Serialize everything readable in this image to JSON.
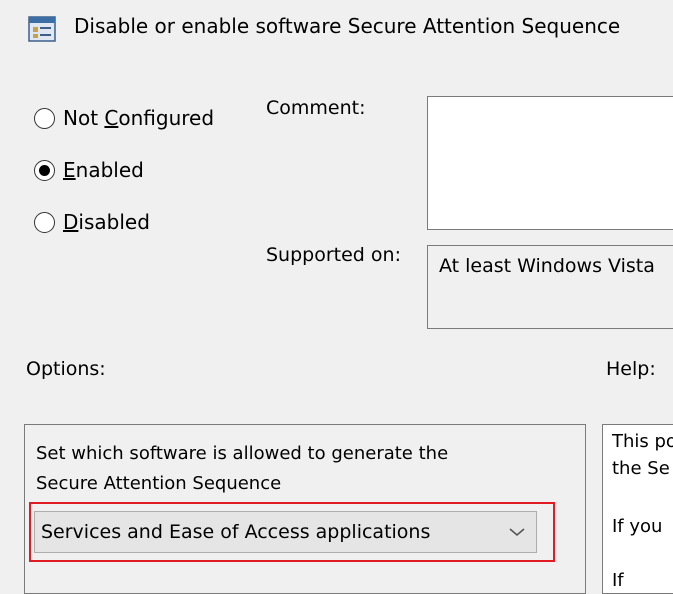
{
  "window": {
    "title": "Disable or enable software Secure Attention Sequence",
    "icon": "policy-setting-icon"
  },
  "state": {
    "options": [
      {
        "before": "Not ",
        "mnemonic": "C",
        "after": "onfigured",
        "selected": false
      },
      {
        "before": "",
        "mnemonic": "E",
        "after": "nabled",
        "selected": true
      },
      {
        "before": "",
        "mnemonic": "D",
        "after": "isabled",
        "selected": false
      }
    ]
  },
  "comment": {
    "label": "Comment:",
    "value": ""
  },
  "supported": {
    "label": "Supported on:",
    "value": "At least Windows Vista"
  },
  "options": {
    "label": "Options:",
    "description_line1": "Set which software is allowed to generate the",
    "description_line2": "Secure Attention Sequence",
    "dropdown_value": "Services and Ease of Access applications"
  },
  "help": {
    "label": "Help:",
    "lines": [
      "This po",
      "the Se",
      "If you",
      "If"
    ]
  },
  "colors": {
    "highlight": "#e01b24",
    "background": "#f0f0f0"
  }
}
